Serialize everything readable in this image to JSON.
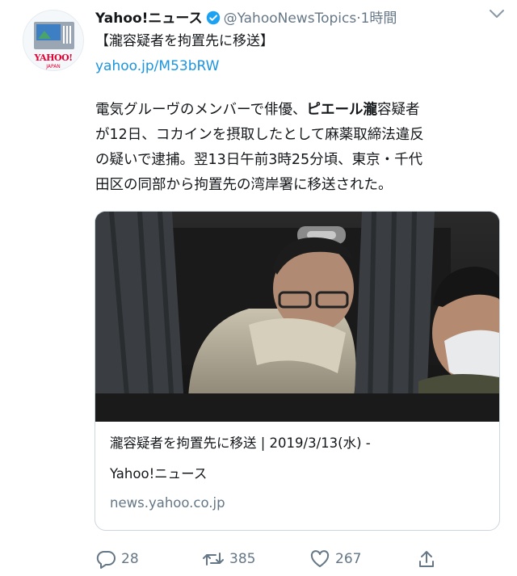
{
  "tweet": {
    "display_name": "Yahoo!ニュース",
    "handle": "@YahooNewsTopics",
    "separator": "·",
    "time": "1時間",
    "headline": "【瀧容疑者を拘置先に移送】",
    "link": "yahoo.jp/M53bRW",
    "body_lines": [
      [
        "電気グルーヴのメンバーで俳優、",
        "ピエール瀧",
        "容疑者"
      ],
      [
        "が12日、コカインを摂取したとして麻薬取締法違反"
      ],
      [
        "の疑いで逮捕。翌13日午前3時25分頃、東京・千代"
      ],
      [
        "田区の同部から拘置先の湾岸署に移送された。"
      ]
    ]
  },
  "avatar": {
    "logo_text": "YAHOO!",
    "logo_sub": "JAPAN"
  },
  "card": {
    "title_line1": "瀧容疑者を拘置先に移送 | 2019/3/13(水) -",
    "title_line2": "Yahoo!ニュース",
    "domain": "news.yahoo.co.jp"
  },
  "actions": {
    "reply_count": "28",
    "retweet_count": "385",
    "like_count": "267"
  },
  "colors": {
    "accent": "#1b95e0",
    "secondary_text": "#657786",
    "verified_badge": "#1da1f2",
    "yahoo_red": "#e60033"
  },
  "icons": [
    "verified-badge-icon",
    "chevron-down-icon",
    "reply-icon",
    "retweet-icon",
    "like-icon",
    "share-icon"
  ]
}
